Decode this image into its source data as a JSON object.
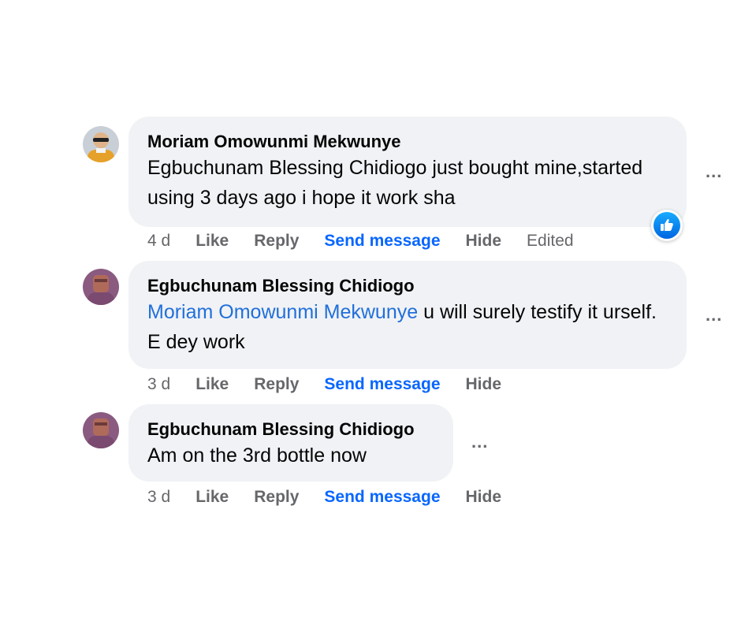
{
  "comments": [
    {
      "author": "Moriam Omowunmi Mekwunye",
      "text": "Egbuchunam Blessing Chidiogo just bought mine,started using 3 days ago i hope it work sha",
      "time": "4 d",
      "like": "Like",
      "reply": "Reply",
      "send_message": "Send message",
      "hide": "Hide",
      "edited": "Edited",
      "reaction_icon": "thumbs-up-icon",
      "more": "..."
    },
    {
      "author": "Egbuchunam Blessing Chidiogo",
      "mention": "Moriam Omowunmi Mekwunye",
      "text": "u will surely testify it urself. E dey work",
      "time": "3 d",
      "like": "Like",
      "reply": "Reply",
      "send_message": "Send message",
      "hide": "Hide",
      "more": "..."
    },
    {
      "author": "Egbuchunam Blessing Chidiogo",
      "text": "Am on the 3rd bottle now",
      "time": "3 d",
      "like": "Like",
      "reply": "Reply",
      "send_message": "Send message",
      "hide": "Hide",
      "more": "..."
    }
  ],
  "colors": {
    "bubble": "#f0f2f5",
    "mention": "#216fdb",
    "send_message": "#0866ff",
    "secondary_text": "#65676b"
  }
}
